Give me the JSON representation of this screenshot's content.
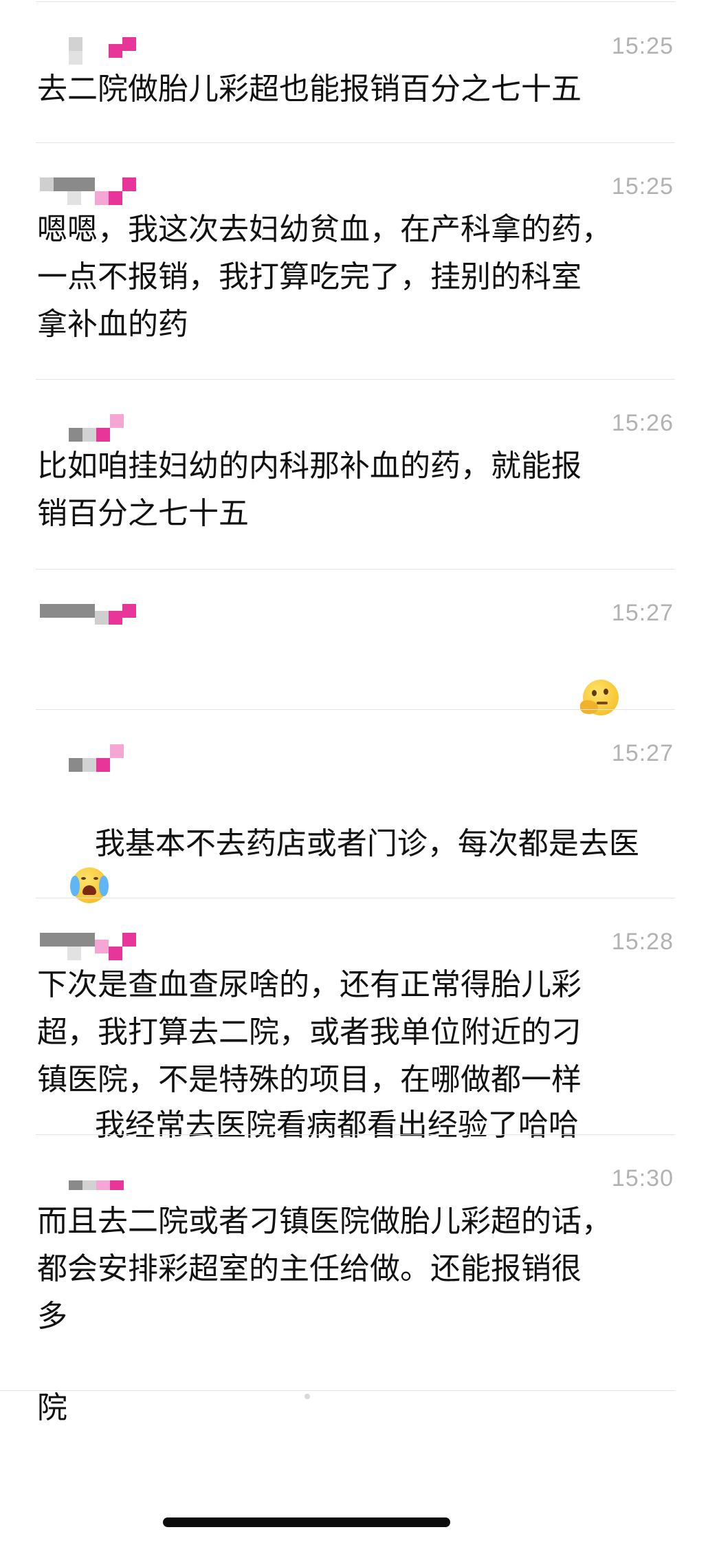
{
  "messages": [
    {
      "time": "15:25",
      "text": "去二院做胎儿彩超也能报销百分之七十五",
      "emoji": ""
    },
    {
      "time": "15:25",
      "text": "嗯嗯，我这次去妇幼贫血，在产科拿的药，\n一点不报销，我打算吃完了，挂别的科室\n拿补血的药",
      "emoji": ""
    },
    {
      "time": "15:26",
      "text": "比如咱挂妇幼的内科那补血的药，就能报\n销百分之七十五",
      "emoji": ""
    },
    {
      "time": "15:27",
      "text": "我经常去医院看病都看出经验了哈哈",
      "emoji": "thinking-face-emoji"
    },
    {
      "time": "15:27",
      "text": "我基本不去药店或者门诊，每次都是去医\n院",
      "emoji": "crying-face-emoji"
    },
    {
      "time": "15:28",
      "text": "下次是查血查尿啥的，还有正常得胎儿彩\n超，我打算去二院，或者我单位附近的刁\n镇医院，不是特殊的项目，在哪做都一样",
      "emoji": ""
    },
    {
      "time": "15:30",
      "text": "而且去二院或者刁镇医院做胎儿彩超的话，\n都会安排彩超室的主任给做。还能报销很\n多",
      "emoji": ""
    }
  ],
  "colors": {
    "text": "#111111",
    "time": "#b2b2b2",
    "divider": "#e4e4e4",
    "blur_pink": "#e8359a",
    "blur_light_pink": "#f6a6d4",
    "blur_gray": "#8a8a8a",
    "blur_light_gray": "#d2d2d2",
    "background": "#ffffff"
  }
}
